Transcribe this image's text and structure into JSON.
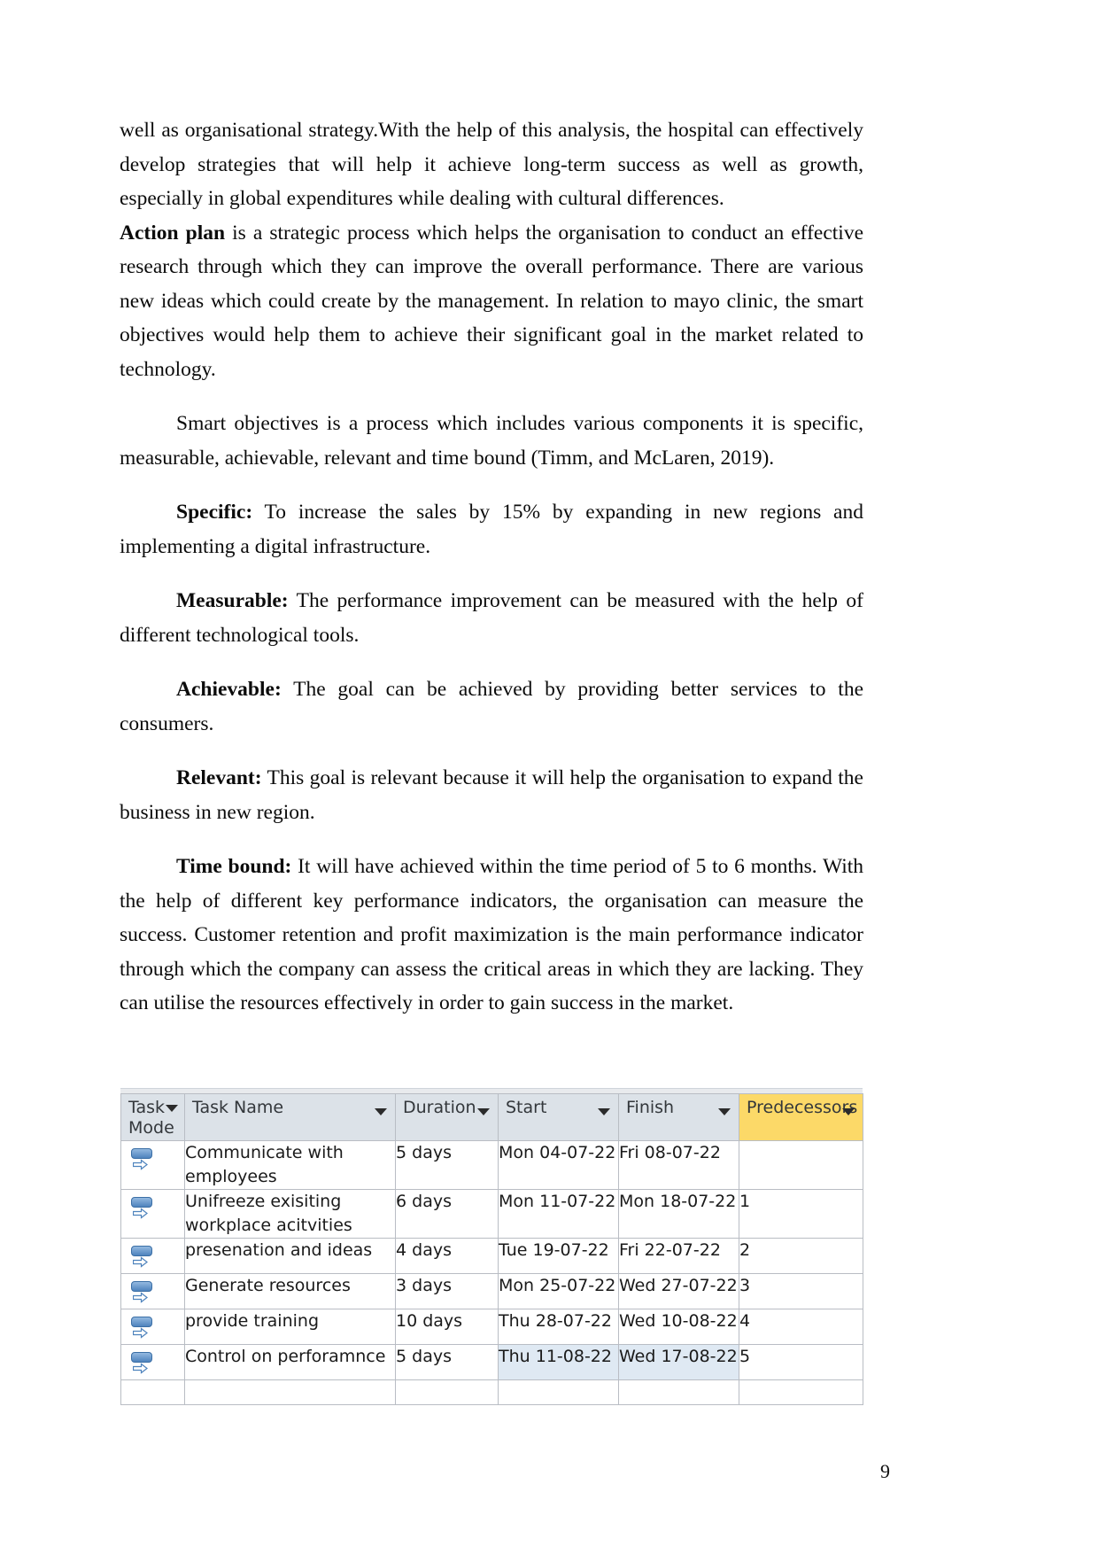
{
  "document": {
    "page_number": "9",
    "paragraphs": [
      {
        "id": "p1",
        "segments": [
          {
            "text": "well as organisational strategy.With the help of this analysis, the hospital can effectively develop strategies that will help it achieve long-term success as well as growth, especially in global expenditures while dealing with cultural differences.",
            "bold": false
          }
        ]
      },
      {
        "id": "p2",
        "segments": [
          {
            "text": "Action plan",
            "bold": true
          },
          {
            "text": " is a strategic process which helps the organisation to conduct an effective research through which they can improve the overall performance. There are various new ideas which could create by the management. In relation to mayo clinic, the smart objectives would help them to achieve their significant goal in the market related to technology.",
            "bold": false
          }
        ]
      },
      {
        "id": "p3",
        "segments": [
          {
            "text": "Smart objectives is a process which includes various components it is specific, measurable, achievable, relevant and time bound (Timm, and McLaren, 2019).",
            "bold": false
          }
        ]
      },
      {
        "id": "p4",
        "segments": [
          {
            "text": "Specific:",
            "bold": true
          },
          {
            "text": " To increase the sales by 15% by expanding in new regions and implementing a digital infrastructure.",
            "bold": false
          }
        ]
      },
      {
        "id": "p5",
        "segments": [
          {
            "text": "Measurable:",
            "bold": true
          },
          {
            "text": " The performance improvement can be measured with the help of different technological tools.",
            "bold": false
          }
        ]
      },
      {
        "id": "p6",
        "segments": [
          {
            "text": "Achievable:",
            "bold": true
          },
          {
            "text": " The goal can be achieved by providing better services to the consumers.",
            "bold": false
          }
        ]
      },
      {
        "id": "p7",
        "segments": [
          {
            "text": "Relevant:",
            "bold": true
          },
          {
            "text": " This goal is relevant because it will help the organisation to expand the business in new region.",
            "bold": false
          }
        ]
      },
      {
        "id": "p8",
        "segments": [
          {
            "text": "Time bound:",
            "bold": true
          },
          {
            "text": " It will have achieved within the time period of 5 to 6 months. With the help of different key performance indicators, the organisation can measure the success. Customer retention and profit maximization is the main performance indicator through which the company can assess the critical areas in which they are lacking. They can utilise the resources effectively in order to gain success in the market.",
            "bold": false
          }
        ]
      }
    ]
  },
  "project_table": {
    "columns": [
      {
        "key": "task_mode",
        "label": "Task Mode",
        "header_style": "yellow",
        "has_filter": true
      },
      {
        "key": "task_name",
        "label": "Task Name",
        "header_style": "gray",
        "has_filter": true
      },
      {
        "key": "duration",
        "label": "Duration",
        "header_style": "gray",
        "has_filter": true
      },
      {
        "key": "start",
        "label": "Start",
        "header_style": "gray",
        "has_filter": true
      },
      {
        "key": "finish",
        "label": "Finish",
        "header_style": "gray",
        "has_filter": true
      },
      {
        "key": "predecessors",
        "label": "Predecessors",
        "header_style": "yellow-strong",
        "has_filter": true
      }
    ],
    "rows": [
      {
        "mode_icon": "manually-scheduled-icon",
        "task_name": "Communicate with employees",
        "duration": "5 days",
        "start": "Mon 04-07-22",
        "finish": "Fri 08-07-22",
        "predecessors": "",
        "highlighted": false
      },
      {
        "mode_icon": "manually-scheduled-icon",
        "task_name": "Unifreeze exisiting workplace acitvities",
        "duration": "6 days",
        "start": "Mon 11-07-22",
        "finish": "Mon 18-07-22",
        "predecessors": "1",
        "highlighted": false
      },
      {
        "mode_icon": "manually-scheduled-icon",
        "task_name": "presenation and ideas",
        "duration": "4 days",
        "start": "Tue 19-07-22",
        "finish": "Fri 22-07-22",
        "predecessors": "2",
        "highlighted": false
      },
      {
        "mode_icon": "manually-scheduled-icon",
        "task_name": "Generate resources",
        "duration": "3 days",
        "start": "Mon 25-07-22",
        "finish": "Wed 27-07-22",
        "predecessors": "3",
        "highlighted": false
      },
      {
        "mode_icon": "manually-scheduled-icon",
        "task_name": "provide training",
        "duration": "10 days",
        "start": "Thu 28-07-22",
        "finish": "Wed 10-08-22",
        "predecessors": "4",
        "highlighted": false
      },
      {
        "mode_icon": "manually-scheduled-icon",
        "task_name": "Control on perforamnce",
        "duration": "5 days",
        "start": "Thu 11-08-22",
        "finish": "Wed 17-08-22",
        "predecessors": "5",
        "highlighted": true
      }
    ],
    "colors": {
      "header_yellow": "#fde68f",
      "header_yellow_strong": "#fcd968",
      "header_gray": "#dce2e8",
      "grid_line": "#b9bdc4",
      "selection_highlight": "#dfe9f3",
      "icon_blue": "#4e83bd"
    }
  }
}
